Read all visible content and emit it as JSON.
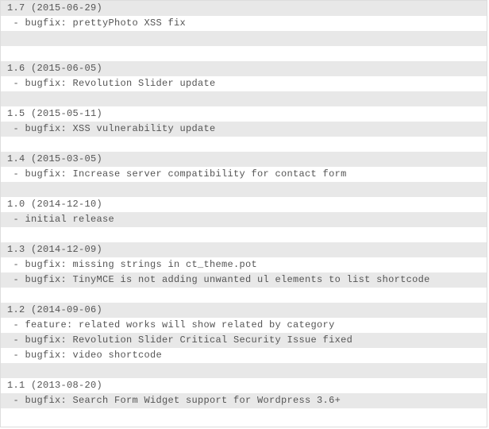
{
  "lines": [
    "1.7 (2015-06-29)",
    " - bugfix: prettyPhoto XSS fix",
    "",
    "",
    "1.6 (2015-06-05)",
    " - bugfix: Revolution Slider update",
    "",
    "1.5 (2015-05-11)",
    " - bugfix: XSS vulnerability update",
    "",
    "1.4 (2015-03-05)",
    " - bugfix: Increase server compatibility for contact form",
    "",
    "1.0 (2014-12-10)",
    " - initial release",
    "",
    "1.3 (2014-12-09)",
    " - bugfix: missing strings in ct_theme.pot",
    " - bugfix: TinyMCE is not adding unwanted ul elements to list shortcode",
    "",
    "1.2 (2014-09-06)",
    " - feature: related works will show related by category",
    " - bugfix: Revolution Slider Critical Security Issue fixed",
    " - bugfix: video shortcode",
    "",
    "1.1 (2013-08-20)",
    " - bugfix: Search Form Widget support for Wordpress 3.6+"
  ]
}
